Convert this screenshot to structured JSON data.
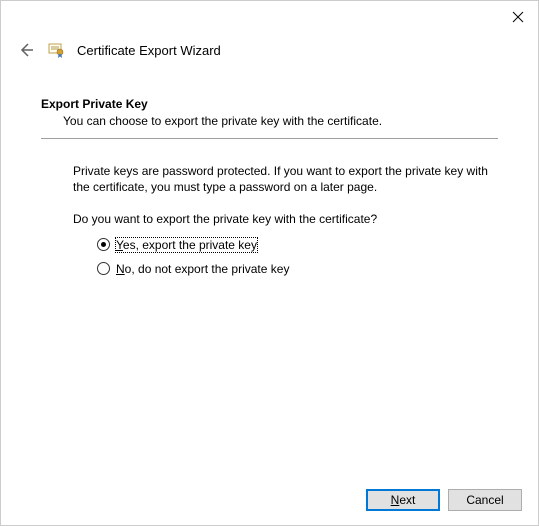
{
  "window": {
    "title": "Certificate Export Wizard"
  },
  "section": {
    "heading": "Export Private Key",
    "subtext": "You can choose to export the private key with the certificate."
  },
  "body": {
    "info": "Private keys are password protected. If you want to export the private key with the certificate, you must type a password on a later page.",
    "question": "Do you want to export the private key with the certificate?"
  },
  "options": {
    "yes_prefix": "Y",
    "yes_rest": "es, export the private key",
    "no_prefix": "N",
    "no_rest": "o, do not export the private key",
    "selected": "yes"
  },
  "buttons": {
    "next_prefix": "N",
    "next_rest": "ext",
    "cancel": "Cancel"
  }
}
